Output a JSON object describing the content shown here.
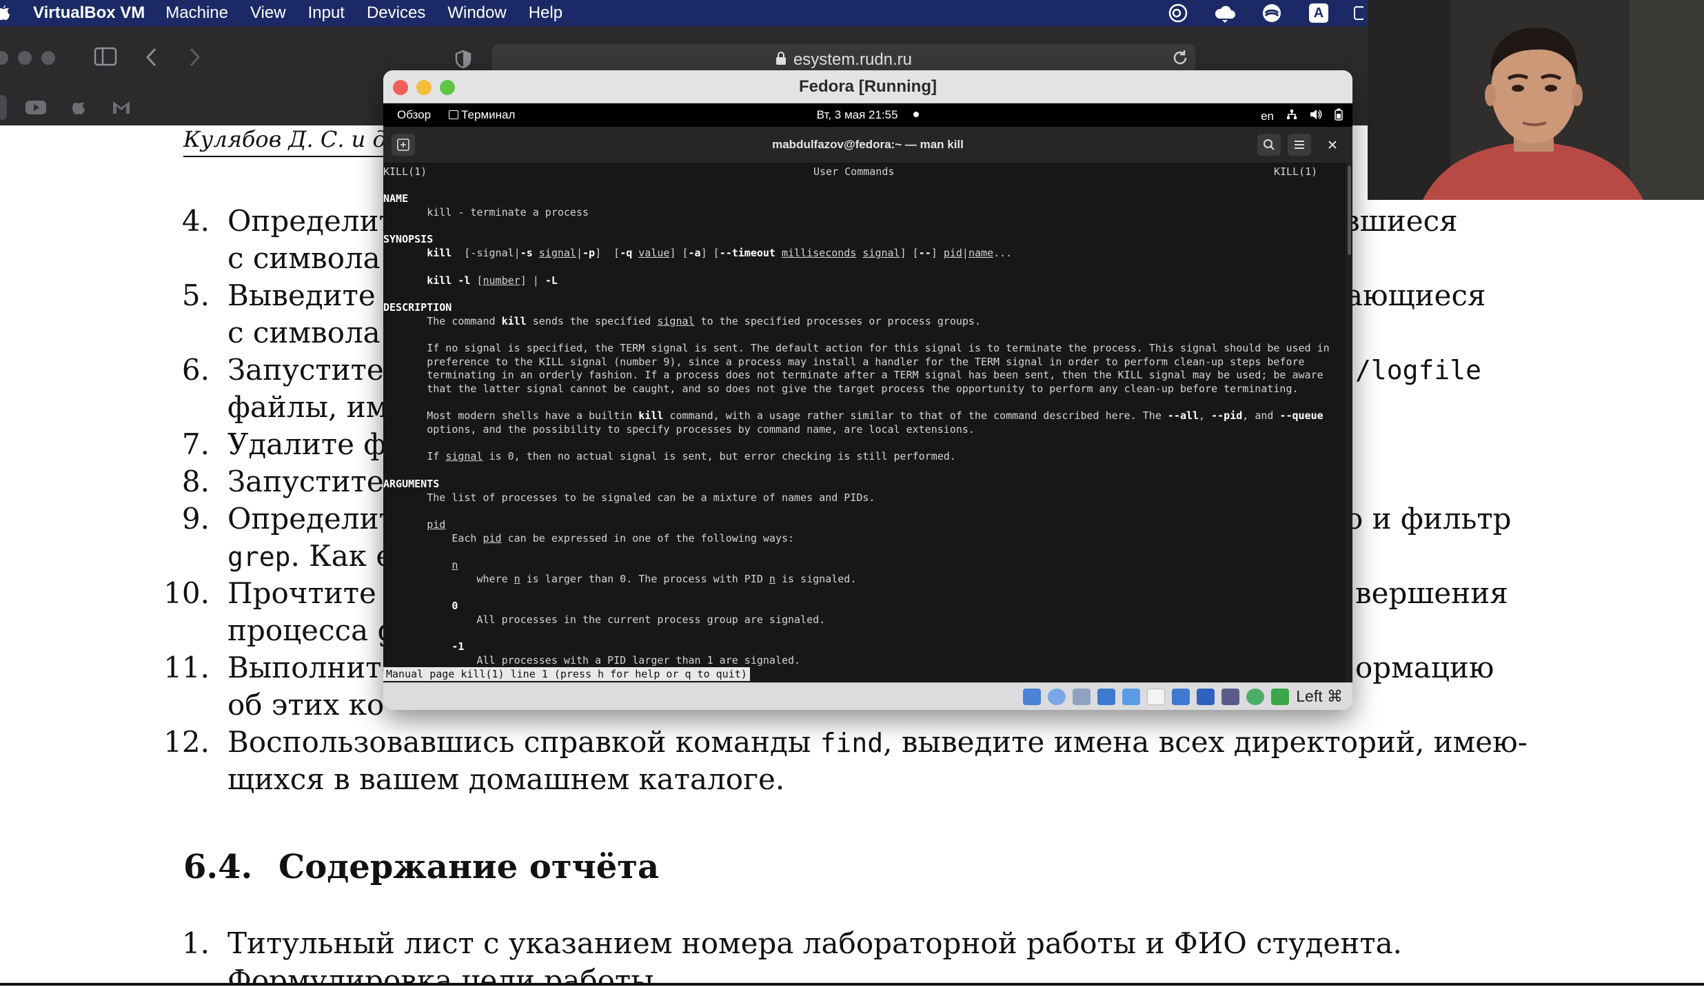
{
  "menubar": {
    "app_name": "VirtualBox VM",
    "items": [
      "Machine",
      "View",
      "Input",
      "Devices",
      "Window",
      "Help"
    ],
    "input_indicator": "A"
  },
  "browser": {
    "url": "esystem.rudn.ru"
  },
  "document": {
    "header": "Кулябов Д. С. и др.",
    "items": [
      {
        "num": "4.",
        "line1": "Определит",
        "line1_right": "навшиеся",
        "line2": "с символа"
      },
      {
        "num": "5.",
        "line1": "Выведите",
        "line1_right": "ающиеся",
        "line2": "с символа"
      },
      {
        "num": "6.",
        "line1": "Запустите",
        "line1_right": "/logfile",
        "line2": "файлы, им"
      },
      {
        "num": "7.",
        "line1": "Удалите фа"
      },
      {
        "num": "8.",
        "line1": "Запустите"
      },
      {
        "num": "9.",
        "line1": "Определит",
        "line1_right": "о и фильтр",
        "line2_mono": "grep",
        "line2": ". Как е"
      },
      {
        "num": "10.",
        "line1": "Прочтите",
        "line1_right": "вершения",
        "line2": "процесса g"
      },
      {
        "num": "11.",
        "line1": "Выполните",
        "line1_right": "ормацию",
        "line2": "об этих ко"
      },
      {
        "num": "12.",
        "line1a": "Воспользовавшись справкой команды ",
        "line1_mono": "find",
        "line1b": ", выведите имена всех директорий, имею-",
        "line2": "щихся в вашем домашнем каталоге."
      }
    ],
    "section_num": "6.4.",
    "section_title": "Содержание отчёта",
    "report_items": [
      {
        "num": "1.",
        "text": "Титульный лист с указанием номера лабораторной работы и ФИО студента."
      },
      {
        "num": "2.",
        "text": "Формулировка цели работы."
      }
    ]
  },
  "vbox": {
    "title": "Fedora [Running]",
    "host_key": "Left ⌘"
  },
  "fedora": {
    "overview": "Обзор",
    "terminal_app": "Терминал",
    "datetime": "Вт, 3 мая  21:55",
    "lang": "en"
  },
  "terminal": {
    "title": "mabdulfazov@fedora:~ — man kill",
    "status": "Manual page kill(1) line 1 (press h for help or q to quit)",
    "header_left": "KILL(1)",
    "header_center": "User Commands",
    "header_right": "KILL(1)",
    "name_heading": "NAME",
    "name_text": "kill - terminate a process",
    "synopsis_heading": "SYNOPSIS",
    "description_heading": "DESCRIPTION",
    "desc_1a": "The command ",
    "desc_1b": "kill",
    "desc_1c": " sends the specified ",
    "desc_1d": "signal",
    "desc_1e": " to the specified processes or process groups.",
    "desc_2": "If no signal is specified, the TERM signal is sent. The default action for this signal is to terminate the process. This signal should be used in",
    "desc_3": "preference to the KILL signal (number 9), since a process may install a handler for the TERM signal in order to perform clean-up steps before",
    "desc_4": "terminating in an orderly fashion. If a process does not terminate after a TERM signal has been sent, then the KILL signal may be used; be aware",
    "desc_5": "that the latter signal cannot be caught, and so does not give the target process the opportunity to perform any clean-up before terminating.",
    "desc_6a": "Most modern shells have a builtin ",
    "desc_6b": "kill",
    "desc_6c": " command, with a usage rather similar to that of the command described here. The ",
    "desc_6d": "--all",
    "desc_6e": ", ",
    "desc_6f": "--pid",
    "desc_6g": ", and ",
    "desc_6h": "--queue",
    "desc_7": "options, and the possibility to specify processes by command name, are local extensions.",
    "desc_8a": "If ",
    "desc_8b": "signal",
    "desc_8c": " is 0, then no actual signal is sent, but error checking is still performed.",
    "arguments_heading": "ARGUMENTS",
    "args_1": "The list of processes to be signaled can be a mixture of names and PIDs.",
    "pid_label": "pid",
    "pid_1a": "Each ",
    "pid_1b": "pid",
    "pid_1c": " can be expressed in one of the following ways:",
    "n_label": "n",
    "n_1a": "where ",
    "n_1b": "n",
    "n_1c": " is larger than 0. The process with PID ",
    "n_1d": "n",
    "n_1e": " is signaled.",
    "zero_label": "0",
    "zero_text": "All processes in the current process group are signaled.",
    "minus1_label": "-1",
    "minus1_text": "All processes with a PID larger than 1 are signaled."
  }
}
